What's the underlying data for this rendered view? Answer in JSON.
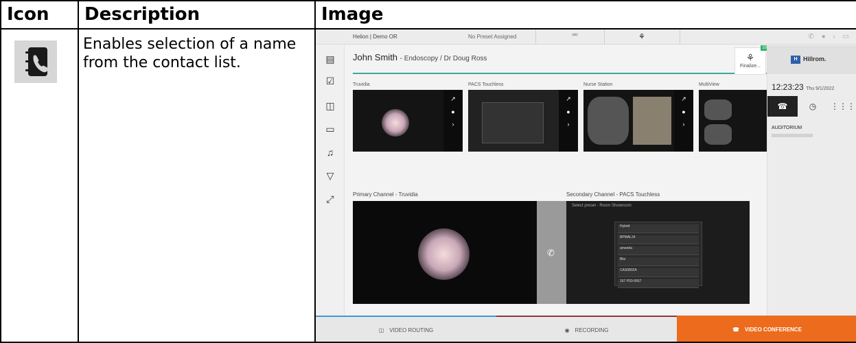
{
  "table": {
    "headers": {
      "icon": "Icon",
      "description": "Description",
      "image": "Image"
    },
    "row": {
      "description": "Enables selection of a name from the contact list."
    }
  },
  "screenshot": {
    "topbar": {
      "title": "Helion | Demo OR",
      "preset": "No Preset Assigned"
    },
    "patient": {
      "name": "John Smith",
      "detail": "- Endoscopy / Dr Doug Ross"
    },
    "finalize": {
      "label": "Finalize...",
      "badge": "10"
    },
    "brand": {
      "logo": "H",
      "name": "Hillrom."
    },
    "clock": {
      "time": "12:23:23",
      "date": "Thu 9/1/2022"
    },
    "contact": {
      "name": "AUDITORIUM"
    },
    "sources": [
      "Truvidia",
      "PACS Touchless",
      "Nurse Station",
      "MultiView"
    ],
    "channels": {
      "primary": "Primary Channel - Truvidia",
      "secondary": "Secondary Channel - PACS Touchless"
    },
    "secondary_header": "Select preset - Room Showroom",
    "preset_list": [
      "Hybrid",
      "BPMAL24",
      "ameerla",
      "Bkz",
      "CAS0802A",
      "167 P03-0667"
    ],
    "bottom": [
      "VIDEO ROUTING",
      "RECORDING",
      "VIDEO CONFERENCE"
    ]
  },
  "colors": {
    "accent_orange": "#ec6b1c",
    "teal": "#3aa99a",
    "brand_blue": "#2f5fa8"
  }
}
